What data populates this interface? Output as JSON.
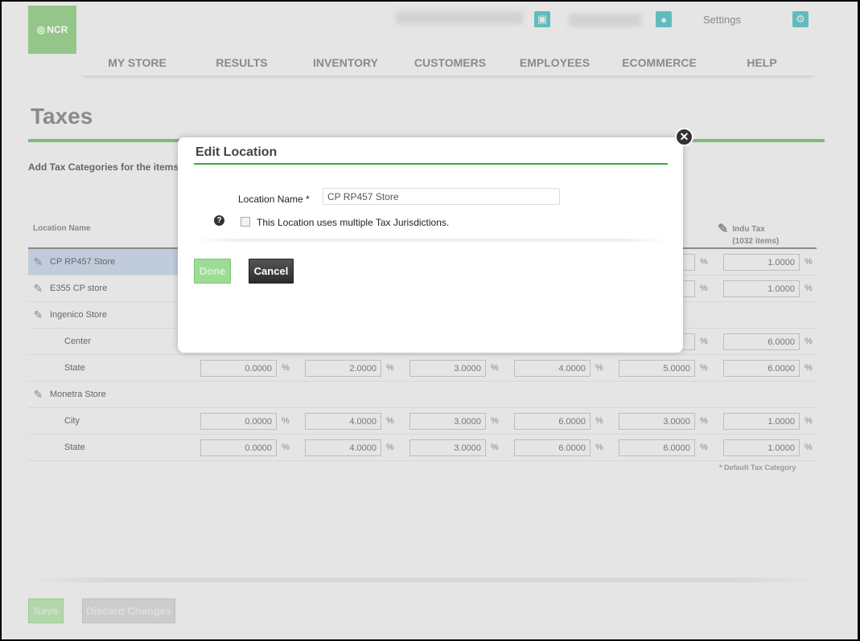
{
  "header": {
    "logo": "NCR",
    "settings_label": "Settings",
    "icons": [
      "store-icon",
      "user-icon",
      "gear-icon"
    ]
  },
  "nav": [
    "MY STORE",
    "RESULTS",
    "INVENTORY",
    "CUSTOMERS",
    "EMPLOYEES",
    "ECOMMERCE",
    "HELP"
  ],
  "page": {
    "title": "Taxes",
    "intro": "Add Tax Categories for the items"
  },
  "table": {
    "col_location": "Location Name",
    "last_col": {
      "name": "Indu Tax",
      "items": "(1032 items)"
    },
    "percent": "%",
    "rows": [
      {
        "name": "CP RP457 Store",
        "editable": true,
        "selected": true,
        "values": [
          "",
          "",
          "",
          "",
          "",
          "1.0000"
        ]
      },
      {
        "name": "E355 CP store",
        "editable": true,
        "values": [
          "",
          "",
          "",
          "",
          "",
          "1.0000"
        ]
      },
      {
        "name": "Ingenico Store",
        "editable": true,
        "values": null
      },
      {
        "name": "Center",
        "sub": true,
        "values": [
          "",
          "",
          "",
          "",
          "",
          "6.0000"
        ]
      },
      {
        "name": "State",
        "sub": true,
        "values": [
          "0.0000",
          "2.0000",
          "3.0000",
          "4.0000",
          "5.0000",
          "6.0000"
        ]
      },
      {
        "name": "Monetra Store",
        "editable": true,
        "values": null
      },
      {
        "name": "City",
        "sub": true,
        "values": [
          "0.0000",
          "4.0000",
          "3.0000",
          "6.0000",
          "3.0000",
          "1.0000"
        ]
      },
      {
        "name": "State",
        "sub": true,
        "values": [
          "0.0000",
          "4.0000",
          "3.0000",
          "6.0000",
          "6.0000",
          "1.0000"
        ]
      }
    ],
    "footnote": "* Default Tax Category"
  },
  "footer": {
    "save": "Save",
    "discard": "Discard Changes"
  },
  "dialog": {
    "title": "Edit Location",
    "location_label": "Location Name *",
    "location_value": "CP RP457 Store",
    "help": "?",
    "checkbox_label": "This Location uses multiple Tax Jurisdictions.",
    "checkbox_checked": false,
    "done": "Done",
    "cancel": "Cancel",
    "close": "✕"
  }
}
